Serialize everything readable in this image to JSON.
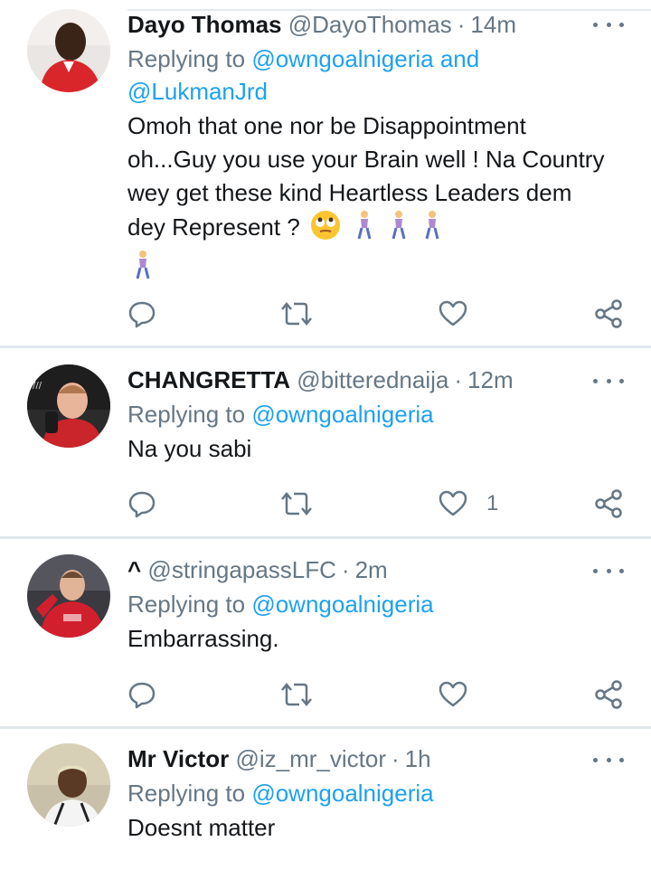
{
  "tweets": [
    {
      "name": "Dayo Thomas",
      "handle": "@DayoThomas",
      "dot": "·",
      "time": "14m",
      "replying_prefix": "Replying to",
      "replying_to": "@owngoalnigeria and @LukmanJrd",
      "body": "Omoh that one nor be Disappointment oh...Guy you use your Brain well ! Na Country wey get these kind Heartless Leaders dem dey Represent ?",
      "emojis": [
        "face-with-rolling-eyes-emoji",
        "person-walking-emoji",
        "person-walking-emoji",
        "person-walking-emoji",
        "person-walking-emoji"
      ],
      "like_count": ""
    },
    {
      "name": "CHANGRETTA",
      "handle": "@bitterednaija",
      "dot": "·",
      "time": "12m",
      "replying_prefix": "Replying to",
      "replying_to": "@owngoalnigeria",
      "body": "Na you sabi",
      "like_count": "1"
    },
    {
      "name": "^",
      "handle": "@stringapassLFC",
      "dot": "·",
      "time": "2m",
      "replying_prefix": "Replying to",
      "replying_to": "@owngoalnigeria",
      "body": "Embarrassing.",
      "like_count": ""
    },
    {
      "name": "Mr Victor",
      "handle": "@iz_mr_victor",
      "dot": "·",
      "time": "1h",
      "replying_prefix": "Replying to",
      "replying_to": "@owngoalnigeria",
      "body": "Doesnt matter",
      "like_count": ""
    }
  ],
  "icons": {
    "reply": "reply-icon",
    "retweet": "retweet-icon",
    "like": "heart-icon",
    "share": "share-icon",
    "more": "more-icon"
  },
  "colors": {
    "link": "#1da1f2",
    "secondary_text": "#657786",
    "primary_text": "#14171a",
    "divider": "#e1e8ed"
  }
}
